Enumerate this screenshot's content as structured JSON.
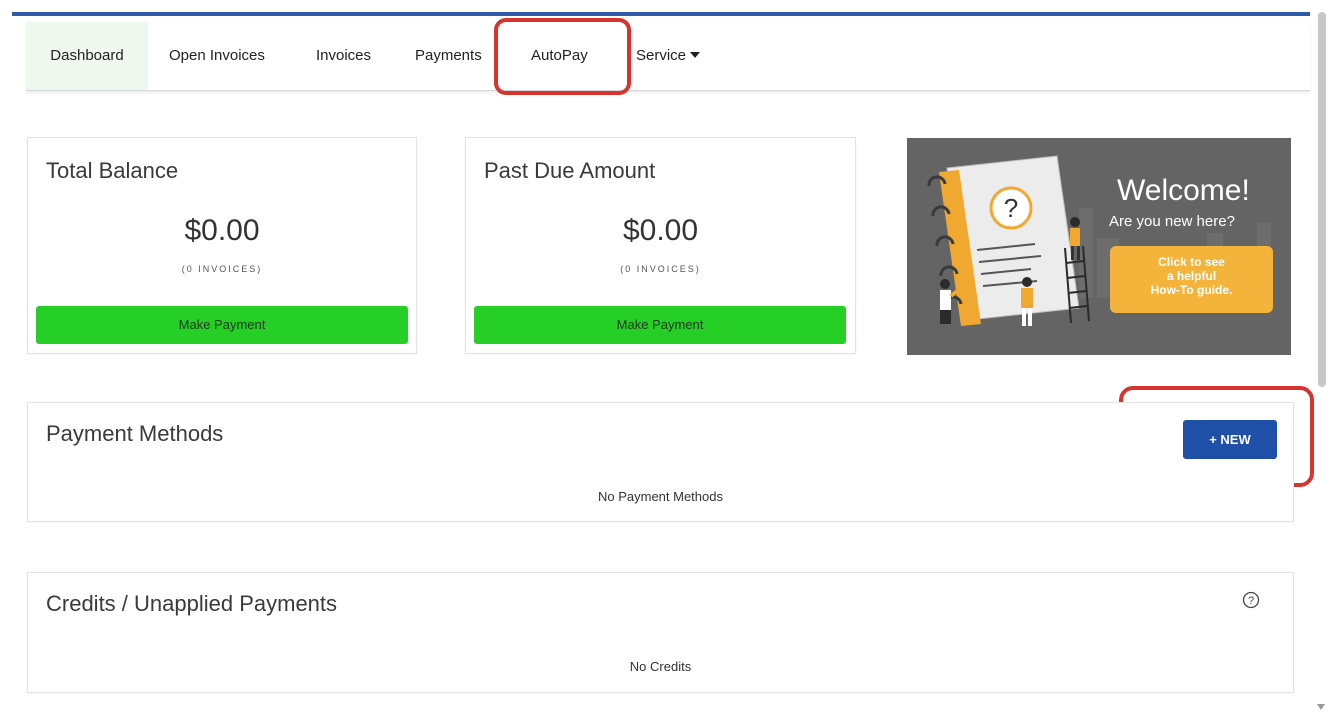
{
  "nav": {
    "items": [
      {
        "label": "Dashboard",
        "active": true
      },
      {
        "label": "Open Invoices"
      },
      {
        "label": "Invoices"
      },
      {
        "label": "Payments"
      },
      {
        "label": "AutoPay"
      },
      {
        "label": "Service",
        "dropdown": true
      }
    ]
  },
  "balance_cards": [
    {
      "title": "Total Balance",
      "amount": "$0.00",
      "count": "(0 INVOICES)",
      "button": "Make Payment"
    },
    {
      "title": "Past Due Amount",
      "amount": "$0.00",
      "count": "(0 INVOICES)",
      "button": "Make Payment"
    }
  ],
  "banner": {
    "welcome": "Welcome!",
    "subtitle": "Are you new here?",
    "cta_line1": "Click to see",
    "cta_line2": "a helpful",
    "cta_line3": "How-To guide."
  },
  "payment_methods": {
    "title": "Payment Methods",
    "new_label": "+ NEW",
    "empty": "No Payment Methods"
  },
  "credits": {
    "title": "Credits / Unapplied Payments",
    "empty": "No Credits"
  },
  "colors": {
    "accent": "#2f59a8",
    "success": "#25cf25",
    "primary_button": "#1f4fa6",
    "highlight": "#d8342e",
    "banner_cta": "#f4b43b"
  }
}
